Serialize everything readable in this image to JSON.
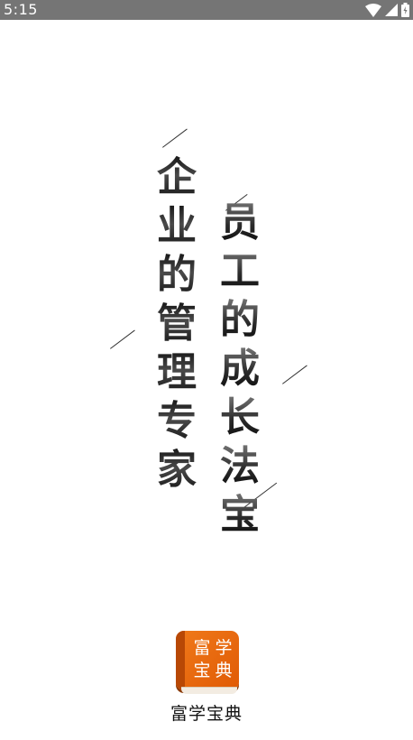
{
  "status_bar": {
    "time": "5:15",
    "icons": [
      "wifi-icon",
      "cell-signal-icon",
      "battery-charging-icon"
    ],
    "background": "#757575"
  },
  "slogan": {
    "left_column": [
      "企",
      "业",
      "的",
      "管",
      "理",
      "专",
      "家"
    ],
    "right_column": [
      "员",
      "工",
      "的",
      "成",
      "长",
      "法",
      "宝"
    ]
  },
  "app": {
    "logo_text": [
      "富",
      "学",
      "宝",
      "典"
    ],
    "name": "富学宝典",
    "brand_color": "#e8650f"
  }
}
